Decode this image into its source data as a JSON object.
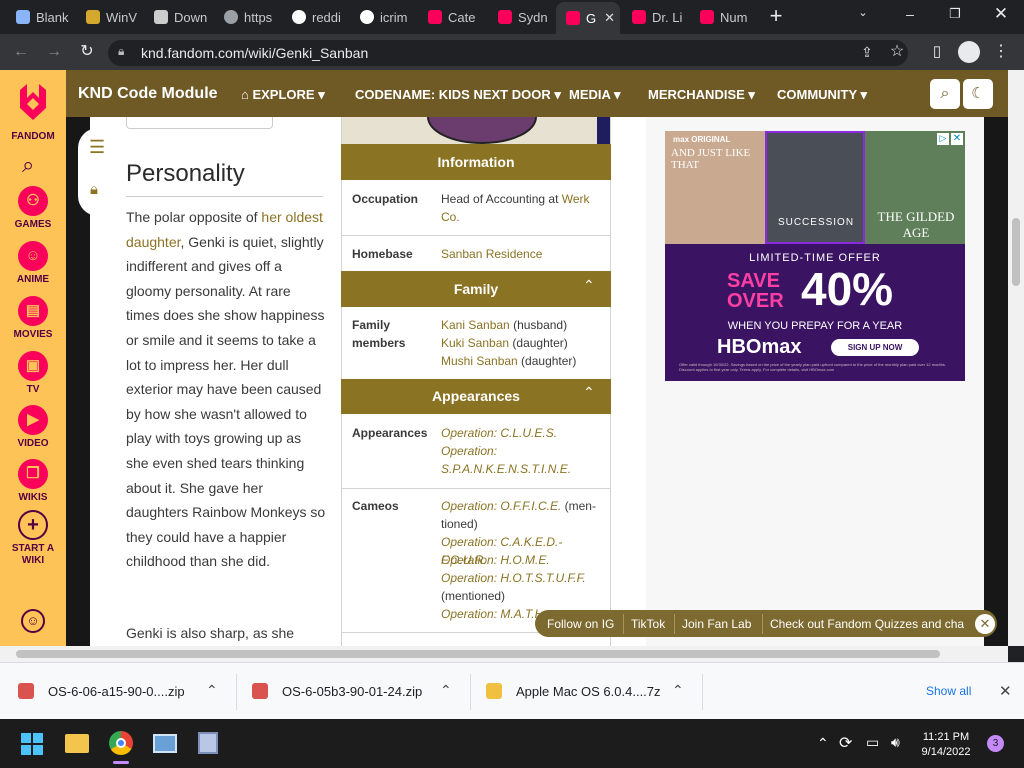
{
  "browser": {
    "tabs": [
      {
        "label": "Blank",
        "icon": "chrome-icon"
      },
      {
        "label": "WinV",
        "icon": "winworld-icon"
      },
      {
        "label": "Down",
        "icon": "download-icon"
      },
      {
        "label": "https",
        "icon": "globe-icon"
      },
      {
        "label": "reddi",
        "icon": "google-icon"
      },
      {
        "label": "icrim",
        "icon": "google-icon"
      },
      {
        "label": "Cate",
        "icon": "fandom-icon"
      },
      {
        "label": "Sydn",
        "icon": "fandom-icon"
      },
      {
        "label": "G",
        "icon": "fandom-icon",
        "active": true
      },
      {
        "label": "Dr. Li",
        "icon": "fandom-icon"
      },
      {
        "label": "Num",
        "icon": "fandom-icon"
      }
    ],
    "url": "knd.fandom.com/wiki/Genki_Sanban"
  },
  "fandom": {
    "logo_label": "FANDOM",
    "rail": [
      {
        "label": "GAMES",
        "icon": "gamepad-icon"
      },
      {
        "label": "ANIME",
        "icon": "anime-icon"
      },
      {
        "label": "MOVIES",
        "icon": "movies-icon"
      },
      {
        "label": "TV",
        "icon": "tv-icon"
      },
      {
        "label": "VIDEO",
        "icon": "video-icon"
      },
      {
        "label": "WIKIS",
        "icon": "wikis-icon"
      },
      {
        "label": "START A WIKI",
        "icon": "plus-icon"
      }
    ],
    "wiki_name": "KND Code Module",
    "nav": [
      "EXPLORE",
      "CODENAME: KIDS NEXT DOOR",
      "MEDIA",
      "MERCHANDISE",
      "COMMUNITY"
    ]
  },
  "article": {
    "section_title": "Personality",
    "para1_a": "The polar opposite of ",
    "para1_link": "her oldest daughter",
    "para1_b": ", Genki is quiet, slightly indifferent and gives off a gloomy personality. At rare times does she show happiness or smile and it seems to take a lot to impress her. Her dull exterior may have been caused by how she wasn't allowed to play with toys growing up as she even shed tears thinking about it. She gave her daughters Rainbow Monkeys so they could have a happier childhood than she did.",
    "para2": "Genki is also sharp, as she"
  },
  "infobox": {
    "information_header": "Information",
    "occupation_label": "Occupation",
    "occupation_text": "Head of Accounting at ",
    "occupation_link": "Werk Co.",
    "homebase_label": "Homebase",
    "homebase_value": "Sanban Residence",
    "family_header": "Family",
    "family_label": "Family members",
    "family": [
      {
        "name": "Kani Sanban",
        "rel": " (husband)"
      },
      {
        "name": "Kuki Sanban",
        "rel": " (daughter)"
      },
      {
        "name": "Mushi Sanban",
        "rel": " (daughter)"
      }
    ],
    "appearances_header": "Appearances",
    "appearances_label": "Appearances",
    "appearances": [
      "Operation: C.L.U.E.S.",
      "Operation: S.P.A.N.K.E.N.S.T.I.N.E."
    ],
    "cameos_label": "Cameos",
    "cameo1": "Operation: O.F.F.I.C.E.",
    "cameo1_note": " (men-",
    "cameo1_note2": "tioned)",
    "cameo2": "Operation: C.A.K.E.D.-F.O.U.R.",
    "cameo3": "Operation: H.O.M.E.",
    "cameo4": "Operation: H.O.T.S.T.U.F.F.",
    "cameo4_note": "(mentioned)",
    "cameo5": "Operation: M.A.T.H."
  },
  "ad": {
    "brand_top": "max ORIGINAL",
    "show1": "AND JUST LIKE THAT",
    "show2": "SUCCESSION",
    "show3": "THE GILDED AGE",
    "offer": "LIMITED-TIME OFFER",
    "save_over": "SAVE OVER",
    "percent": "40%",
    "prepay": "WHEN YOU PREPAY FOR A YEAR",
    "logo": "HBOmax",
    "cta": "SIGN UP NOW",
    "fine": "Offer valid through 10/30/22. Savings based on the price of the yearly plan paid upfront compared to the price of the monthly plan paid over 12 months. Discount applies to first year only. Terms apply. For complete details, visit HBOmax.com"
  },
  "fanbar": [
    "Follow on IG",
    "TikTok",
    "Join Fan Lab",
    "Check out Fandom Quizzes and cha"
  ],
  "downloads": {
    "items": [
      "OS-6-06-a15-90-0....zip",
      "OS-6-05b3-90-01-24.zip",
      "Apple Mac OS 6.0.4....7z"
    ],
    "show_all": "Show all"
  },
  "taskbar": {
    "time": "11:21 PM",
    "date": "9/14/2022",
    "badge": "3"
  },
  "colors": {
    "fandom_rail": "#fec356",
    "header": "#6f5a26",
    "infobox_header": "#8b7324",
    "link": "#8b7324"
  }
}
